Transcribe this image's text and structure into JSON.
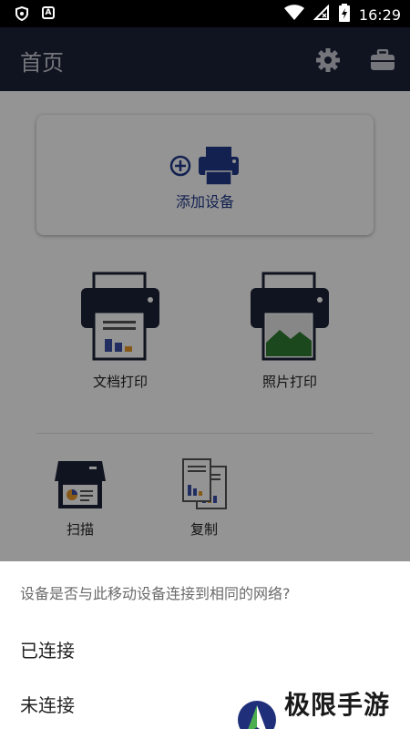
{
  "status_bar": {
    "time": "16:29",
    "app_icon_label": "A"
  },
  "app_bar": {
    "title": "首页"
  },
  "add_device": {
    "label": "添加设备"
  },
  "tiles": {
    "doc_print": "文档打印",
    "photo_print": "照片打印",
    "scan": "扫描",
    "copy": "复制"
  },
  "sheet": {
    "question": "设备是否与此移动设备连接到相同的网络?",
    "options": [
      "已连接",
      "未连接"
    ]
  },
  "watermark": {
    "text": "极限手游网"
  },
  "colors": {
    "appbar": "#1d2438",
    "accent": "#1f3a8a",
    "printer": "#1d2438"
  }
}
